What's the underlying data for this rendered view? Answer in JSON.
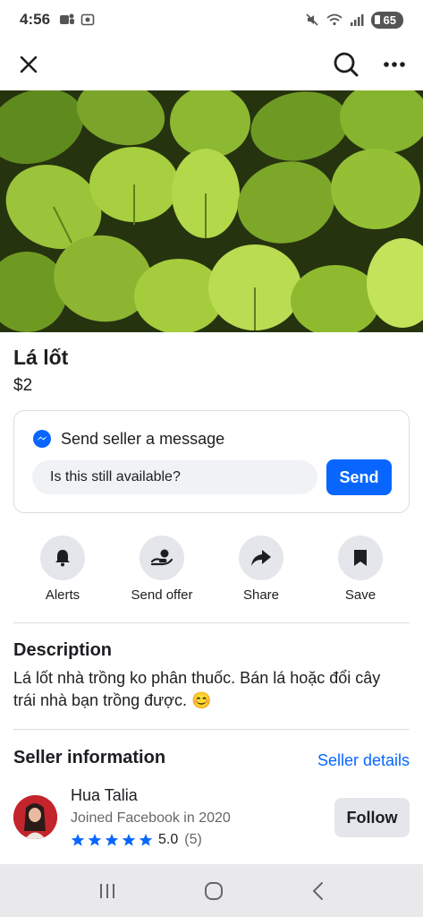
{
  "status_bar": {
    "time": "4:56",
    "battery": "65",
    "icons": [
      "teams-icon",
      "screen-record-icon",
      "mute-icon",
      "wifi-icon",
      "signal-icon",
      "battery-icon"
    ]
  },
  "app_bar": {
    "icons": [
      "close-icon",
      "search-icon",
      "more-icon"
    ]
  },
  "listing": {
    "title": "Lá lốt",
    "price": "$2",
    "image": "betel-leaves-photo"
  },
  "message": {
    "header": "Send seller a message",
    "input_value": "Is this still available?",
    "send_label": "Send"
  },
  "actions": [
    {
      "label": "Alerts",
      "icon": "bell-icon"
    },
    {
      "label": "Send offer",
      "icon": "offer-icon"
    },
    {
      "label": "Share",
      "icon": "share-icon"
    },
    {
      "label": "Save",
      "icon": "bookmark-icon"
    }
  ],
  "description": {
    "title": "Description",
    "text": "Lá lốt nhà trồng ko phân thuốc. Bán lá hoặc đổi cây trái nhà bạn trồng được. 😊"
  },
  "seller": {
    "section_title": "Seller information",
    "details_link": "Seller details",
    "name": "Hua Talia",
    "joined": "Joined Facebook in 2020",
    "rating": "5.0",
    "rating_count": "(5)",
    "follow_label": "Follow"
  },
  "colors": {
    "accent": "#0866ff",
    "secondary_bg": "#e4e6eb"
  }
}
